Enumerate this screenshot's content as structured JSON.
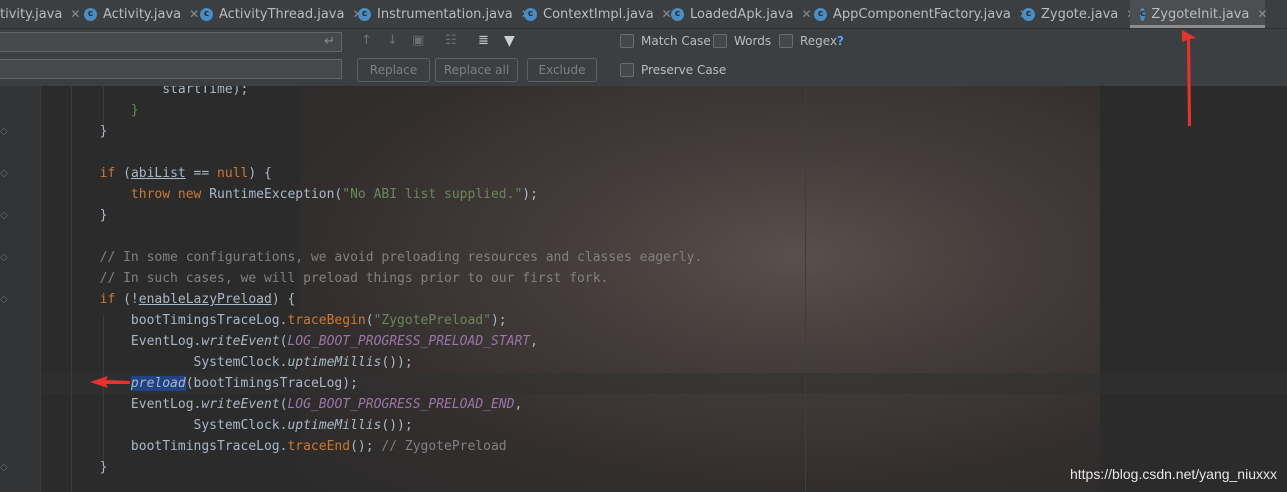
{
  "tabs": [
    {
      "label": "tivity.java",
      "active": false
    },
    {
      "label": "Activity.java",
      "active": false
    },
    {
      "label": "ActivityThread.java",
      "active": false
    },
    {
      "label": "Instrumentation.java",
      "active": false
    },
    {
      "label": "ContextImpl.java",
      "active": false
    },
    {
      "label": "LoadedApk.java",
      "active": false
    },
    {
      "label": "AppComponentFactory.java",
      "active": false
    },
    {
      "label": "Zygote.java",
      "active": false
    },
    {
      "label": "ZygoteInit.java",
      "active": true
    }
  ],
  "find": {
    "search_value": "",
    "replace_value": "",
    "replace_label": "Replace",
    "replace_all_label": "Replace all",
    "exclude_label": "Exclude",
    "match_case_label": "Match Case",
    "words_label": "Words",
    "regex_label": "Regex",
    "preserve_case_label": "Preserve Case",
    "help_label": "?"
  },
  "code_lines": [
    "                startTime);",
    "            }",
    "        }",
    "",
    "        if (abiList == null) {",
    "            throw new RuntimeException(\"No ABI list supplied.\");",
    "        }",
    "",
    "        // In some configurations, we avoid preloading resources and classes eagerly.",
    "        // In such cases, we will preload things prior to our first fork.",
    "        if (!enableLazyPreload) {",
    "            bootTimingsTraceLog.traceBegin(\"ZygotePreload\");",
    "            EventLog.writeEvent(LOG_BOOT_PROGRESS_PRELOAD_START,",
    "                    SystemClock.uptimeMillis());",
    "            preload(bootTimingsTraceLog);",
    "            EventLog.writeEvent(LOG_BOOT_PROGRESS_PRELOAD_END,",
    "                    SystemClock.uptimeMillis());",
    "            bootTimingsTraceLog.traceEnd(); // ZygotePreload",
    "        }"
  ],
  "watermark": "https://blog.csdn.net/yang_niuxxx",
  "colors": {
    "keyword": "#cc7832",
    "string": "#6a8759",
    "comment": "#808080",
    "field": "#9876aa",
    "method": "#ffc66d",
    "annotation_arrow": "#e8322e"
  }
}
